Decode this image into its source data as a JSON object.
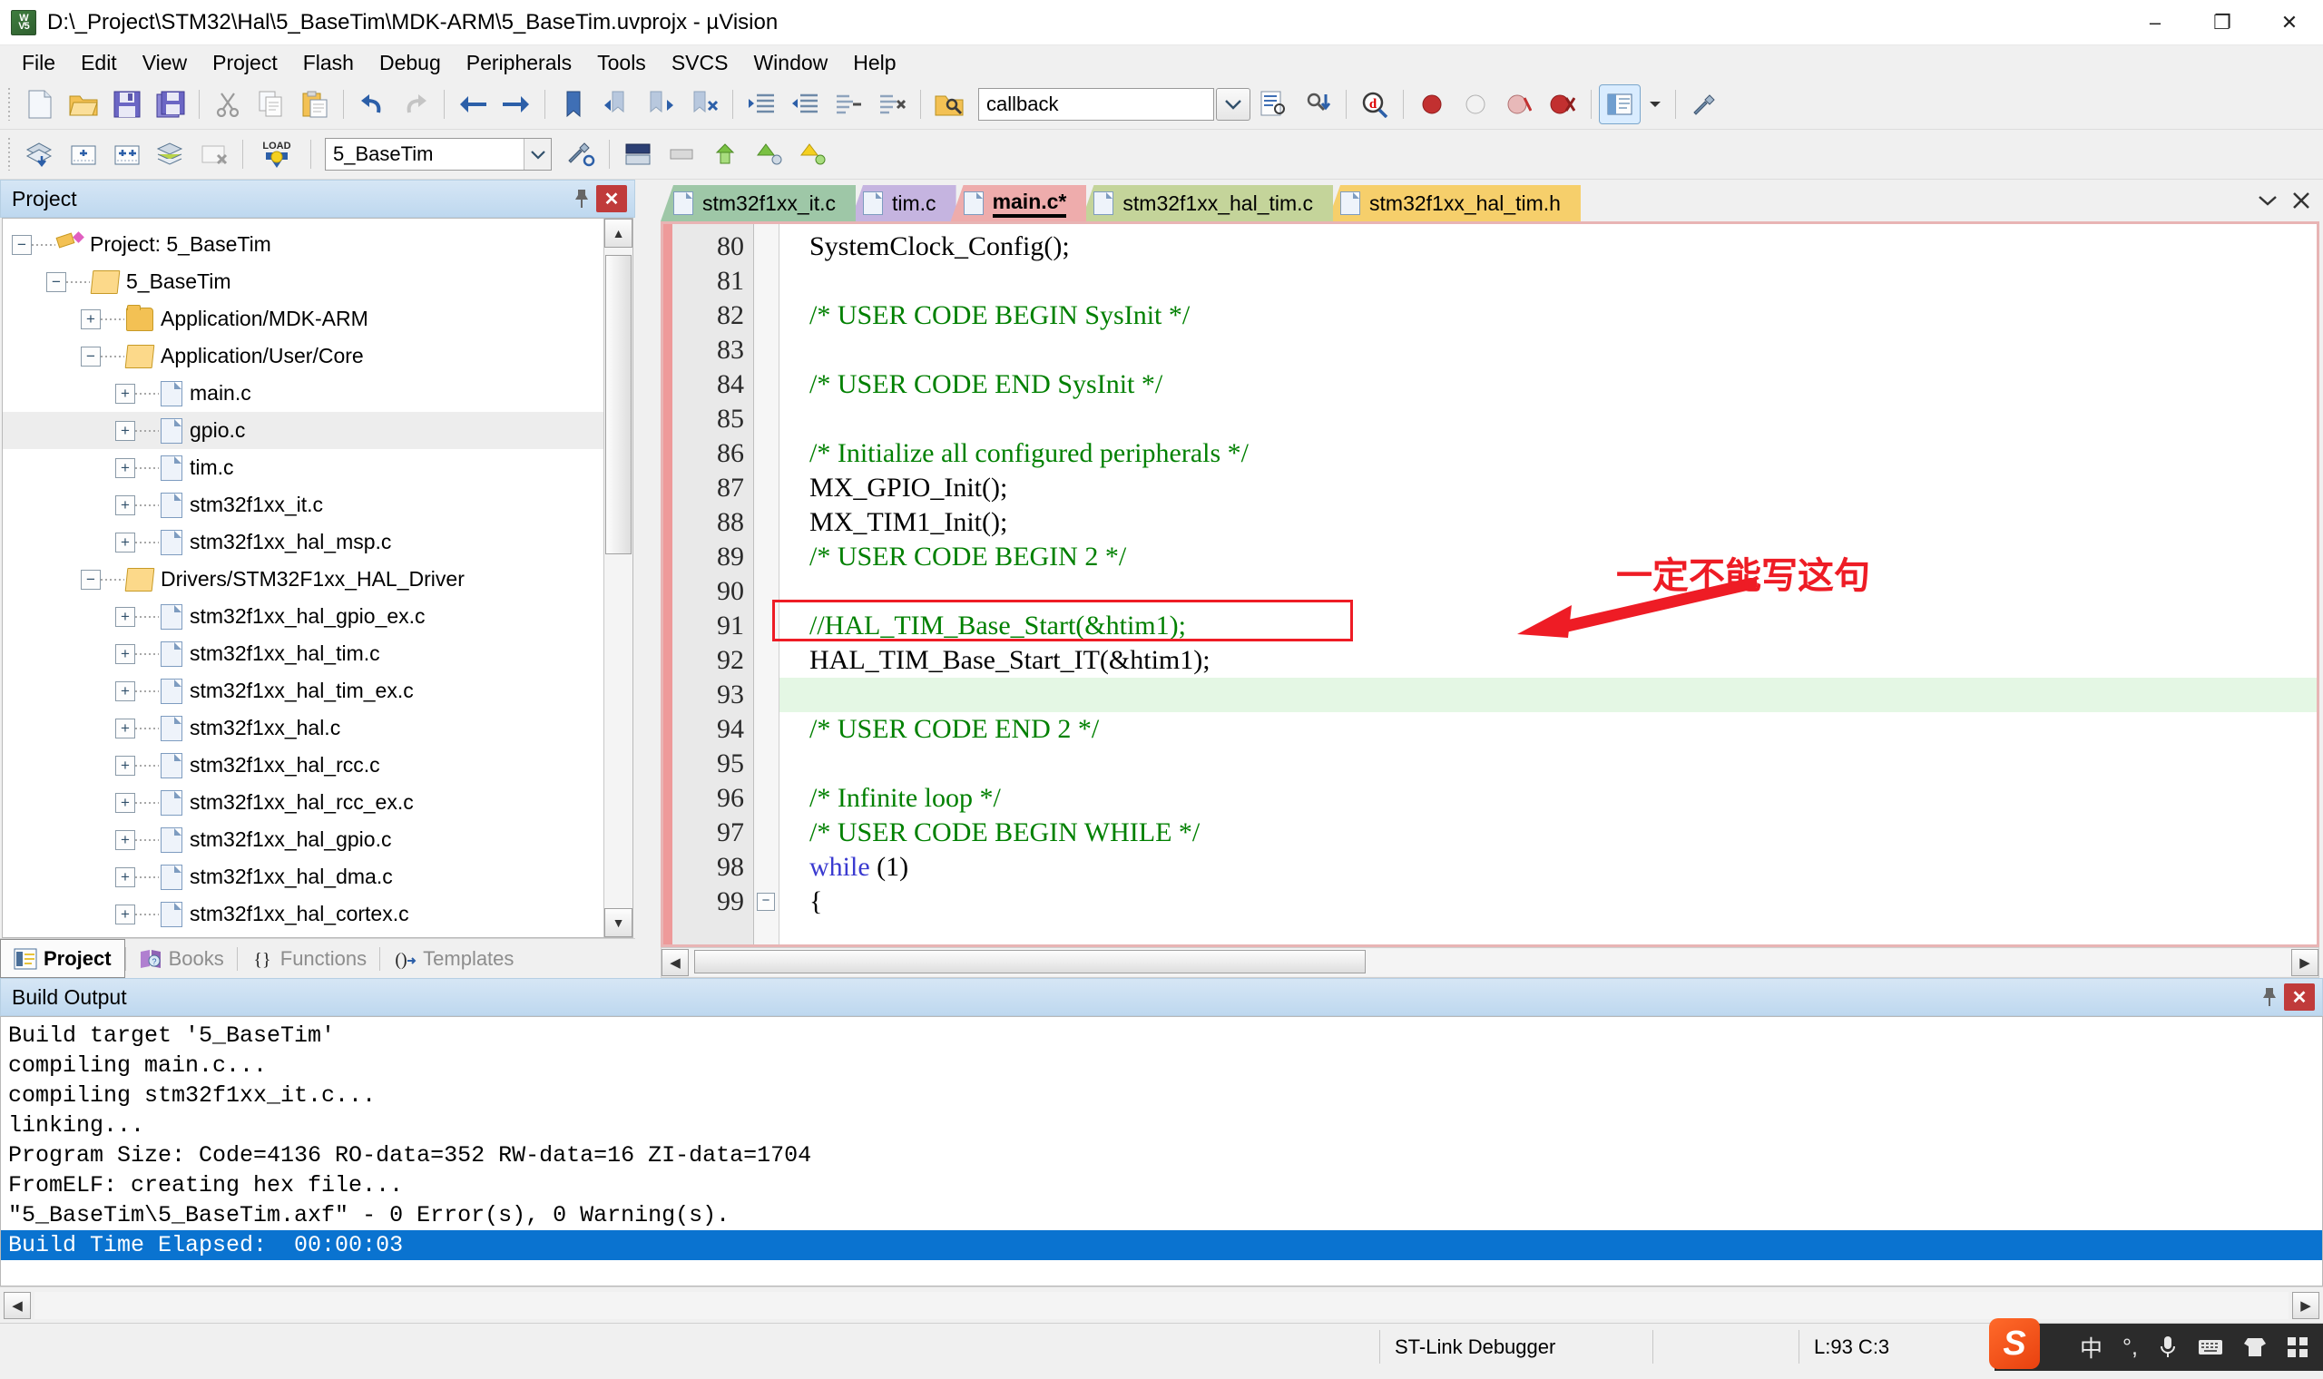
{
  "window": {
    "title": "D:\\_Project\\STM32\\Hal\\5_BaseTim\\MDK-ARM\\5_BaseTim.uvprojx - µVision",
    "app_icon": "uvision-icon",
    "minimize": "–",
    "maximize": "❐",
    "close": "✕"
  },
  "menu": {
    "items": [
      "File",
      "Edit",
      "View",
      "Project",
      "Flash",
      "Debug",
      "Peripherals",
      "Tools",
      "SVCS",
      "Window",
      "Help"
    ]
  },
  "toolbar1": {
    "search_value": "callback",
    "buttons": [
      "new-file-icon",
      "open-file-icon",
      "save-icon",
      "save-all-icon",
      "cut-icon",
      "copy-icon",
      "paste-icon",
      "undo-icon",
      "redo-icon",
      "navigate-back-icon",
      "navigate-forward-icon",
      "bookmark-icon",
      "bookmark-prev-icon",
      "bookmark-next-icon",
      "bookmark-clear-icon",
      "indent-icon",
      "outdent-icon",
      "comment-icon",
      "uncomment-icon",
      "find-in-files-icon",
      "find-icon",
      "insert-breakpoint-icon",
      "disable-breakpoint-icon",
      "disable-all-breakpoints-icon",
      "kill-all-breakpoints-icon",
      "window-layout-icon",
      "configure-icon"
    ]
  },
  "toolbar2": {
    "target_value": "5_BaseTim",
    "buttons": [
      "build-icon",
      "rebuild-icon",
      "batch-build-icon",
      "translate-icon",
      "stop-build-icon",
      "download-icon",
      "target-options-icon",
      "manage-runtime-icon",
      "multi-project-icon",
      "pack-installer-icon",
      "manage-project-items-icon",
      "configuration-wizard-icon"
    ]
  },
  "project_pane": {
    "header": "Project",
    "pin_icon": "pin-icon",
    "close_icon": "close-icon",
    "tree": [
      {
        "label": "Project: 5_BaseTim",
        "depth": 0,
        "expander": "−",
        "icon": "project-icon",
        "selected": false
      },
      {
        "label": "5_BaseTim",
        "depth": 1,
        "expander": "−",
        "icon": "target-folder-icon",
        "selected": false
      },
      {
        "label": "Application/MDK-ARM",
        "depth": 2,
        "expander": "+",
        "icon": "folder-icon",
        "selected": false
      },
      {
        "label": "Application/User/Core",
        "depth": 2,
        "expander": "−",
        "icon": "folder-open-icon",
        "selected": false
      },
      {
        "label": "main.c",
        "depth": 3,
        "expander": "+",
        "icon": "c-file-icon",
        "selected": false
      },
      {
        "label": "gpio.c",
        "depth": 3,
        "expander": "+",
        "icon": "c-file-icon",
        "selected": true
      },
      {
        "label": "tim.c",
        "depth": 3,
        "expander": "+",
        "icon": "c-file-icon",
        "selected": false
      },
      {
        "label": "stm32f1xx_it.c",
        "depth": 3,
        "expander": "+",
        "icon": "c-file-icon",
        "selected": false
      },
      {
        "label": "stm32f1xx_hal_msp.c",
        "depth": 3,
        "expander": "+",
        "icon": "c-file-icon",
        "selected": false
      },
      {
        "label": "Drivers/STM32F1xx_HAL_Driver",
        "depth": 2,
        "expander": "−",
        "icon": "folder-open-icon",
        "selected": false
      },
      {
        "label": "stm32f1xx_hal_gpio_ex.c",
        "depth": 3,
        "expander": "+",
        "icon": "c-file-icon",
        "selected": false
      },
      {
        "label": "stm32f1xx_hal_tim.c",
        "depth": 3,
        "expander": "+",
        "icon": "c-file-icon",
        "selected": false
      },
      {
        "label": "stm32f1xx_hal_tim_ex.c",
        "depth": 3,
        "expander": "+",
        "icon": "c-file-icon",
        "selected": false
      },
      {
        "label": "stm32f1xx_hal.c",
        "depth": 3,
        "expander": "+",
        "icon": "c-file-icon",
        "selected": false
      },
      {
        "label": "stm32f1xx_hal_rcc.c",
        "depth": 3,
        "expander": "+",
        "icon": "c-file-icon",
        "selected": false
      },
      {
        "label": "stm32f1xx_hal_rcc_ex.c",
        "depth": 3,
        "expander": "+",
        "icon": "c-file-icon",
        "selected": false
      },
      {
        "label": "stm32f1xx_hal_gpio.c",
        "depth": 3,
        "expander": "+",
        "icon": "c-file-icon",
        "selected": false
      },
      {
        "label": "stm32f1xx_hal_dma.c",
        "depth": 3,
        "expander": "+",
        "icon": "c-file-icon",
        "selected": false
      },
      {
        "label": "stm32f1xx_hal_cortex.c",
        "depth": 3,
        "expander": "+",
        "icon": "c-file-icon",
        "selected": false
      }
    ],
    "tabs": [
      {
        "label": "Project",
        "icon": "project-tab-icon",
        "active": true
      },
      {
        "label": "Books",
        "icon": "books-tab-icon",
        "active": false
      },
      {
        "label": "Functions",
        "icon": "functions-tab-icon",
        "active": false
      },
      {
        "label": "Templates",
        "icon": "templates-tab-icon",
        "active": false
      }
    ]
  },
  "editor": {
    "tabs": [
      {
        "label": "stm32f1xx_it.c",
        "color": "#9ec7a7",
        "active": false
      },
      {
        "label": "tim.c",
        "color": "#c5b4e0",
        "active": false
      },
      {
        "label": "main.c*",
        "color": "#eeacac",
        "active": true
      },
      {
        "label": "stm32f1xx_hal_tim.c",
        "color": "#c4d49a",
        "active": false
      },
      {
        "label": "stm32f1xx_hal_tim.h",
        "color": "#f6cf6b",
        "active": false
      }
    ],
    "tabbar_menu_icon": "chevron-down-icon",
    "tabbar_close_icon": "close-icon",
    "first_line": 80,
    "lines": [
      {
        "n": 80,
        "segments": [
          {
            "t": "  SystemClock_Config();",
            "c": "plain"
          }
        ],
        "hl": false,
        "fold": ""
      },
      {
        "n": 81,
        "segments": [
          {
            "t": "",
            "c": "plain"
          }
        ],
        "hl": false,
        "fold": ""
      },
      {
        "n": 82,
        "segments": [
          {
            "t": "  /* USER CODE BEGIN SysInit */",
            "c": "comment"
          }
        ],
        "hl": false,
        "fold": ""
      },
      {
        "n": 83,
        "segments": [
          {
            "t": "",
            "c": "plain"
          }
        ],
        "hl": false,
        "fold": ""
      },
      {
        "n": 84,
        "segments": [
          {
            "t": "  /* USER CODE END SysInit */",
            "c": "comment"
          }
        ],
        "hl": false,
        "fold": ""
      },
      {
        "n": 85,
        "segments": [
          {
            "t": "",
            "c": "plain"
          }
        ],
        "hl": false,
        "fold": ""
      },
      {
        "n": 86,
        "segments": [
          {
            "t": "  /* Initialize all configured peripherals */",
            "c": "comment"
          }
        ],
        "hl": false,
        "fold": ""
      },
      {
        "n": 87,
        "segments": [
          {
            "t": "  MX_GPIO_Init();",
            "c": "plain"
          }
        ],
        "hl": false,
        "fold": ""
      },
      {
        "n": 88,
        "segments": [
          {
            "t": "  MX_TIM1_Init();",
            "c": "plain"
          }
        ],
        "hl": false,
        "fold": ""
      },
      {
        "n": 89,
        "segments": [
          {
            "t": "  /* USER CODE BEGIN 2 */",
            "c": "comment"
          }
        ],
        "hl": false,
        "fold": ""
      },
      {
        "n": 90,
        "segments": [
          {
            "t": "",
            "c": "plain"
          }
        ],
        "hl": false,
        "fold": ""
      },
      {
        "n": 91,
        "segments": [
          {
            "t": "  //HAL_TIM_Base_Start(&htim1);",
            "c": "comment"
          }
        ],
        "hl": false,
        "fold": ""
      },
      {
        "n": 92,
        "segments": [
          {
            "t": "  HAL_TIM_Base_Start_IT(&htim1);",
            "c": "plain"
          }
        ],
        "hl": false,
        "fold": ""
      },
      {
        "n": 93,
        "segments": [
          {
            "t": "",
            "c": "plain"
          }
        ],
        "hl": true,
        "fold": ""
      },
      {
        "n": 94,
        "segments": [
          {
            "t": "  /* USER CODE END 2 */",
            "c": "comment"
          }
        ],
        "hl": false,
        "fold": ""
      },
      {
        "n": 95,
        "segments": [
          {
            "t": "",
            "c": "plain"
          }
        ],
        "hl": false,
        "fold": ""
      },
      {
        "n": 96,
        "segments": [
          {
            "t": "  /* Infinite loop */",
            "c": "comment"
          }
        ],
        "hl": false,
        "fold": ""
      },
      {
        "n": 97,
        "segments": [
          {
            "t": "  /* USER CODE BEGIN WHILE */",
            "c": "comment"
          }
        ],
        "hl": false,
        "fold": ""
      },
      {
        "n": 98,
        "segments": [
          {
            "t": "  while",
            "c": "keyword"
          },
          {
            "t": " (1)",
            "c": "plain"
          }
        ],
        "hl": false,
        "fold": ""
      },
      {
        "n": 99,
        "segments": [
          {
            "t": "  {",
            "c": "plain"
          }
        ],
        "hl": false,
        "fold": "−"
      }
    ],
    "annotation": {
      "text": "一定不能写这句",
      "color": "#ee1c25",
      "arrow": "arrow-pointing-left"
    }
  },
  "build_output": {
    "header": "Build Output",
    "pin_icon": "pin-icon",
    "close_icon": "close-icon",
    "lines": [
      {
        "t": "Build target '5_BaseTim'",
        "sel": false
      },
      {
        "t": "compiling main.c...",
        "sel": false
      },
      {
        "t": "compiling stm32f1xx_it.c...",
        "sel": false
      },
      {
        "t": "linking...",
        "sel": false
      },
      {
        "t": "Program Size: Code=4136 RO-data=352 RW-data=16 ZI-data=1704",
        "sel": false
      },
      {
        "t": "FromELF: creating hex file...",
        "sel": false
      },
      {
        "t": "\"5_BaseTim\\5_BaseTim.axf\" - 0 Error(s), 0 Warning(s).",
        "sel": false
      },
      {
        "t": "Build Time Elapsed:  00:00:03",
        "sel": true
      }
    ]
  },
  "statusbar": {
    "debugger": "ST-Link Debugger",
    "cursor": "L:93 C:3",
    "ime": {
      "logo": "sogou-logo-icon",
      "mode": "中",
      "punctuation": "°,",
      "mic": "mic-icon",
      "keyboard": "keyboard-icon",
      "skin": "skin-icon",
      "apps": "apps-icon"
    }
  }
}
